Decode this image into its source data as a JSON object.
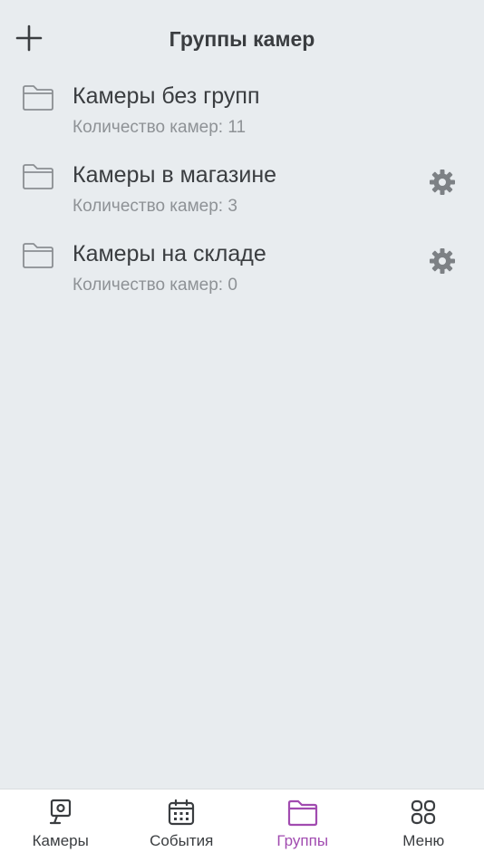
{
  "header": {
    "title": "Группы камер",
    "add_icon": "plus-icon"
  },
  "groups": [
    {
      "name": "Камеры без групп",
      "count": "Количество камер: 11",
      "has_settings": false
    },
    {
      "name": "Камеры в магазине",
      "count": "Количество камер: 3",
      "has_settings": true
    },
    {
      "name": "Камеры на складе",
      "count": "Количество камер: 0",
      "has_settings": true
    }
  ],
  "tabbar": {
    "active_color": "#a14bb0",
    "items": [
      {
        "label": "Камеры",
        "icon": "camera-icon",
        "active": false
      },
      {
        "label": "События",
        "icon": "calendar-icon",
        "active": false
      },
      {
        "label": "Группы",
        "icon": "folder-icon",
        "active": true
      },
      {
        "label": "Меню",
        "icon": "grid-icon",
        "active": false
      }
    ]
  }
}
